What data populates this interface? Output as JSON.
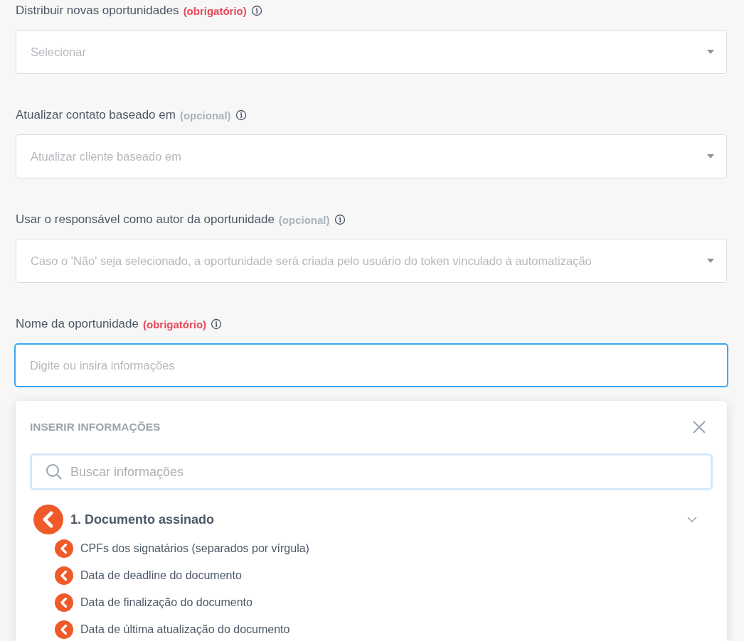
{
  "fields": [
    {
      "label": "Distribuir novas oportunidades",
      "tag": "(obrigatório)",
      "required": true,
      "kind": "select",
      "placeholder": "Selecionar",
      "focused": false
    },
    {
      "label": "Atualizar contato baseado em",
      "tag": "(opcional)",
      "required": false,
      "kind": "select",
      "placeholder": "Atualizar cliente baseado em",
      "focused": false
    },
    {
      "label": "Usar o responsável como autor da oportunidade",
      "tag": "(opcional)",
      "required": false,
      "kind": "select",
      "placeholder": "Caso o 'Não' seja selecionado, a oportunidade será criada pelo usuário do token vinculado à automatização",
      "focused": false
    },
    {
      "label": "Nome da oportunidade",
      "tag": "(obrigatório)",
      "required": true,
      "kind": "text",
      "placeholder": "Digite ou insira informações",
      "focused": true
    }
  ],
  "popup": {
    "title": "INSERIR INFORMAÇÕES",
    "search": {
      "placeholder": "Buscar informações"
    },
    "group": {
      "title": "1. Documento assinado",
      "expanded": true,
      "items": [
        {
          "label": "CPFs dos signatários (separados por vírgula)"
        },
        {
          "label": "Data de deadline do documento"
        },
        {
          "label": "Data de finalização do documento"
        },
        {
          "label": "Data de última atualização do documento"
        }
      ]
    }
  }
}
